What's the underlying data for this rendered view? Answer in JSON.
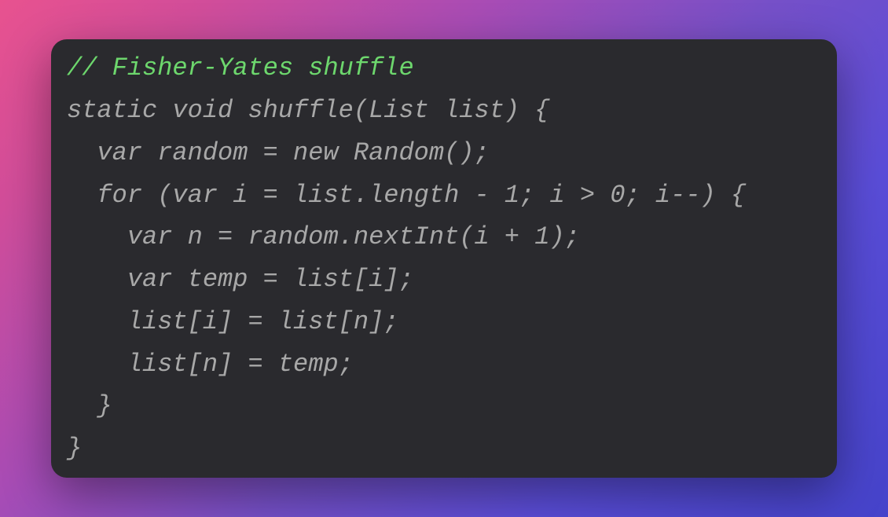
{
  "code": {
    "lines": [
      {
        "text": "// Fisher-Yates shuffle",
        "class": "comment"
      },
      {
        "text": "static void shuffle(List list) {",
        "class": ""
      },
      {
        "text": "  var random = new Random();",
        "class": ""
      },
      {
        "text": "  for (var i = list.length - 1; i > 0; i--) {",
        "class": ""
      },
      {
        "text": "    var n = random.nextInt(i + 1);",
        "class": ""
      },
      {
        "text": "    var temp = list[i];",
        "class": ""
      },
      {
        "text": "    list[i] = list[n];",
        "class": ""
      },
      {
        "text": "    list[n] = temp;",
        "class": ""
      },
      {
        "text": "  }",
        "class": ""
      },
      {
        "text": "}",
        "class": ""
      }
    ]
  }
}
